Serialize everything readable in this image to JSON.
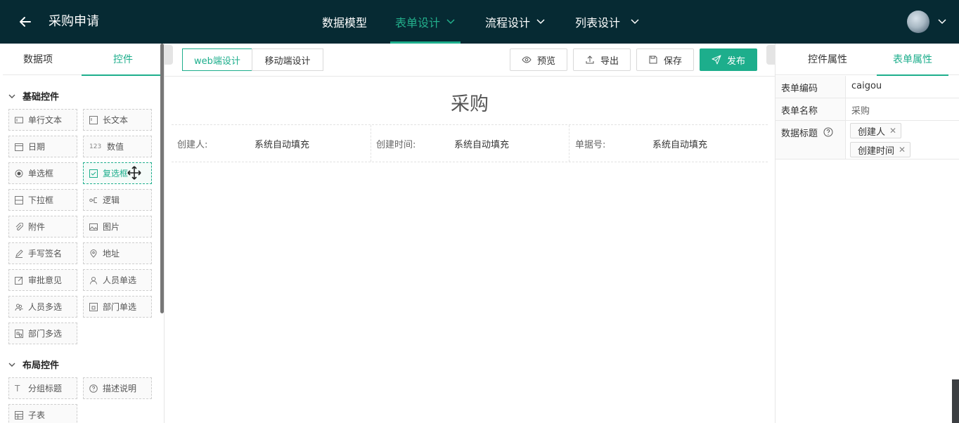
{
  "header": {
    "title": "采购申请",
    "nav": [
      {
        "label": "数据模型",
        "active": false,
        "has_dropdown": false
      },
      {
        "label": "表单设计",
        "active": true,
        "has_dropdown": true
      },
      {
        "label": "流程设计",
        "active": false,
        "has_dropdown": true
      },
      {
        "label": "列表设计",
        "active": false,
        "has_dropdown": true
      }
    ]
  },
  "colors": {
    "accent": "#1dae8c",
    "topbar": "#062a33"
  },
  "left_panel": {
    "tabs": [
      "数据项",
      "控件"
    ],
    "active_tab": "控件",
    "sections": [
      {
        "title": "基础控件",
        "items": [
          {
            "label": "单行文本",
            "icon": "text-input-icon"
          },
          {
            "label": "长文本",
            "icon": "textarea-icon"
          },
          {
            "label": "日期",
            "icon": "calendar-icon"
          },
          {
            "label": "数值",
            "icon": "number-icon"
          },
          {
            "label": "单选框",
            "icon": "radio-icon"
          },
          {
            "label": "复选框",
            "icon": "checkbox-icon",
            "selected": true
          },
          {
            "label": "下拉框",
            "icon": "dropdown-icon"
          },
          {
            "label": "逻辑",
            "icon": "logic-icon"
          },
          {
            "label": "附件",
            "icon": "paperclip-icon"
          },
          {
            "label": "图片",
            "icon": "image-icon"
          },
          {
            "label": "手写签名",
            "icon": "pen-icon"
          },
          {
            "label": "地址",
            "icon": "location-icon"
          },
          {
            "label": "审批意见",
            "icon": "edit-icon"
          },
          {
            "label": "人员单选",
            "icon": "user-icon"
          },
          {
            "label": "人员多选",
            "icon": "users-icon"
          },
          {
            "label": "部门单选",
            "icon": "department-icon"
          },
          {
            "label": "部门多选",
            "icon": "departments-icon"
          }
        ]
      },
      {
        "title": "布局控件",
        "items": [
          {
            "label": "分组标题",
            "icon": "title-icon"
          },
          {
            "label": "描述说明",
            "icon": "help-icon"
          },
          {
            "label": "子表",
            "icon": "table-icon"
          }
        ]
      }
    ]
  },
  "toolbar": {
    "modes": [
      "web端设计",
      "移动端设计"
    ],
    "active_mode": "web端设计",
    "preview": "预览",
    "export": "导出",
    "save": "保存",
    "publish": "发布"
  },
  "form": {
    "title": "采购",
    "fields": [
      {
        "label": "创建人:",
        "value": "系统自动填充"
      },
      {
        "label": "创建时间:",
        "value": "系统自动填充"
      },
      {
        "label": "单据号:",
        "value": "系统自动填充"
      }
    ]
  },
  "right_panel": {
    "tabs": [
      "控件属性",
      "表单属性"
    ],
    "active_tab": "表单属性",
    "props": {
      "code_label": "表单编码",
      "code_value": "caigou",
      "name_label": "表单名称",
      "name_value": "采购",
      "data_title_label": "数据标题",
      "data_title_tags": [
        "创建人",
        "创建时间"
      ]
    }
  }
}
